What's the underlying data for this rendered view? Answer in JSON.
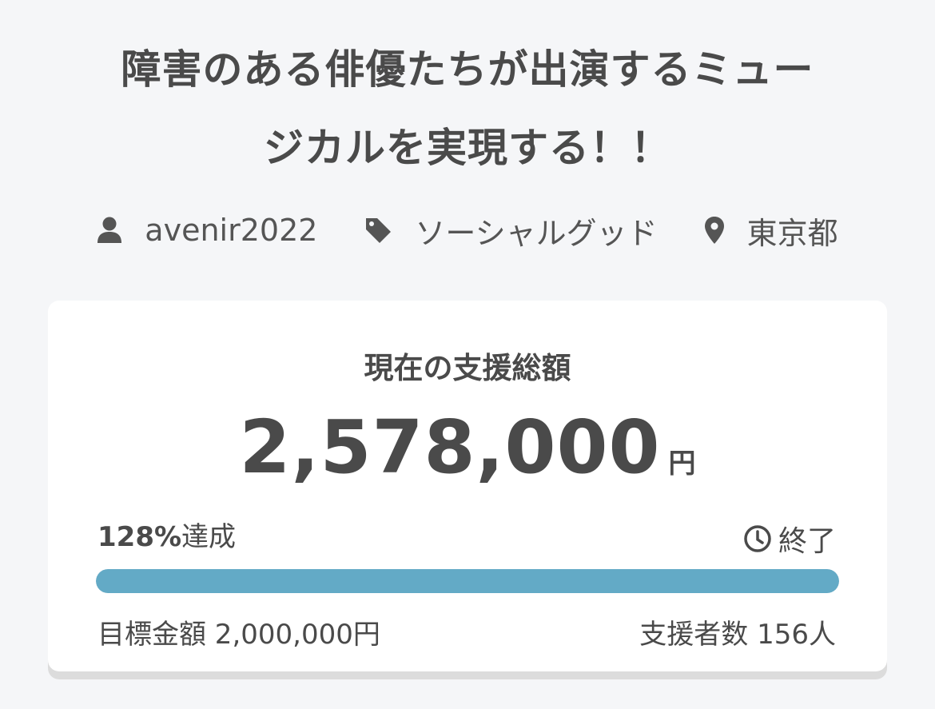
{
  "project": {
    "title_line1": "障害のある俳優たちが出演するミュー",
    "title_line2": "ジカルを実現する！！",
    "author": "avenir2022",
    "category": "ソーシャルグッド",
    "location": "東京都"
  },
  "funding": {
    "label": "現在の支援総額",
    "amount": "2,578,000",
    "currency": "円",
    "percent": "128%",
    "percent_suffix": "達成",
    "status": "終了",
    "progress_fraction": 1.0,
    "goal_text": "目標金額 2,000,000円",
    "backers_text": "支援者数 156人"
  },
  "icons": {
    "author": "user-icon",
    "category": "tag-icon",
    "location": "map-pin-icon",
    "status": "clock-icon"
  },
  "colors": {
    "progress": "#63aac6",
    "background": "#f5f6f8",
    "text": "#4a4a4a"
  }
}
